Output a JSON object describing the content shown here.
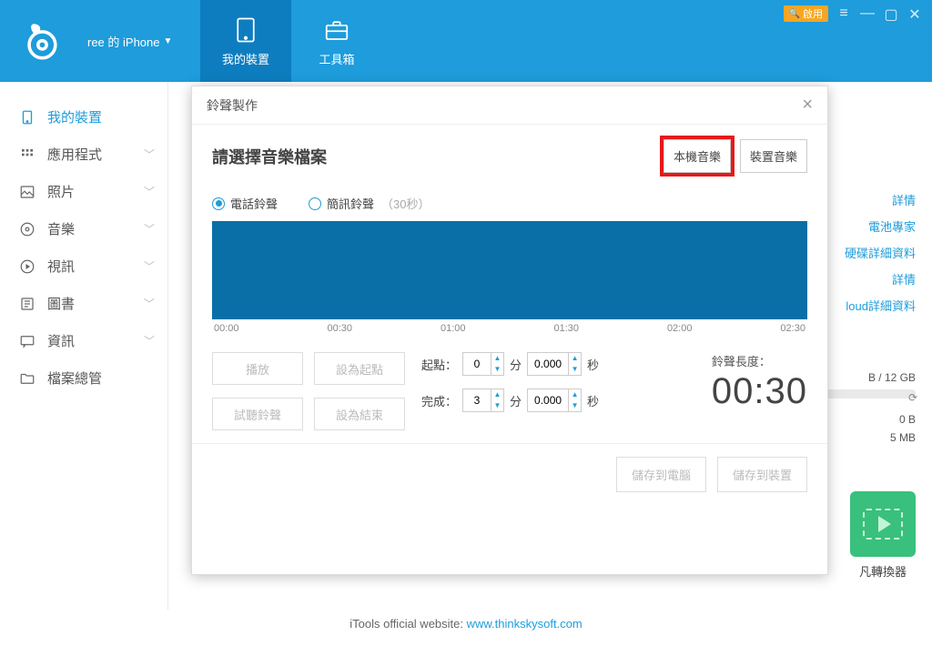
{
  "header": {
    "device_label": "ree 的 iPhone",
    "tab_device": "我的裝置",
    "tab_toolbox": "工具箱",
    "enable": "啟用"
  },
  "sidebar": {
    "items": [
      {
        "label": "我的裝置",
        "icon": "device"
      },
      {
        "label": "應用程式",
        "icon": "apps",
        "chev": true
      },
      {
        "label": "照片",
        "icon": "photo",
        "chev": true
      },
      {
        "label": "音樂",
        "icon": "music",
        "chev": true
      },
      {
        "label": "視訊",
        "icon": "video",
        "chev": true
      },
      {
        "label": "圖書",
        "icon": "book",
        "chev": true
      },
      {
        "label": "資訊",
        "icon": "message",
        "chev": true
      },
      {
        "label": "檔案總管",
        "icon": "folder"
      }
    ]
  },
  "right_links": {
    "l1": "詳情",
    "l2": "電池專家",
    "l3": "硬碟詳細資料",
    "l4": "詳情",
    "l5": "loud詳細資料"
  },
  "storage": {
    "cap": "B / 12 GB",
    "b0": "0 B",
    "b1": "5 MB"
  },
  "green_label": "凡轉換器",
  "footer": {
    "text": "iTools official website: ",
    "link": "www.thinkskysoft.com"
  },
  "modal": {
    "title": "鈴聲製作",
    "select_title": "請選擇音樂檔案",
    "btn_local": "本機音樂",
    "btn_device": "裝置音樂",
    "radio_phone": "電話鈴聲",
    "radio_sms": "簡訊鈴聲",
    "radio_sms_sub": "（30秒）",
    "ticks": [
      "00:00",
      "00:30",
      "01:00",
      "01:30",
      "02:00",
      "02:30"
    ],
    "btn_play": "播放",
    "btn_start": "設為起點",
    "btn_preview": "試聽鈴聲",
    "btn_end": "設為結束",
    "lbl_start": "起點：",
    "lbl_end": "完成：",
    "unit_min": "分",
    "unit_sec": "秒",
    "val_start_min": "0",
    "val_start_sec": "0.000",
    "val_end_min": "3",
    "val_end_sec": "0.000",
    "len_label": "鈴聲長度：",
    "len_value": "00:30",
    "save_pc": "儲存到電腦",
    "save_dev": "儲存到裝置"
  }
}
